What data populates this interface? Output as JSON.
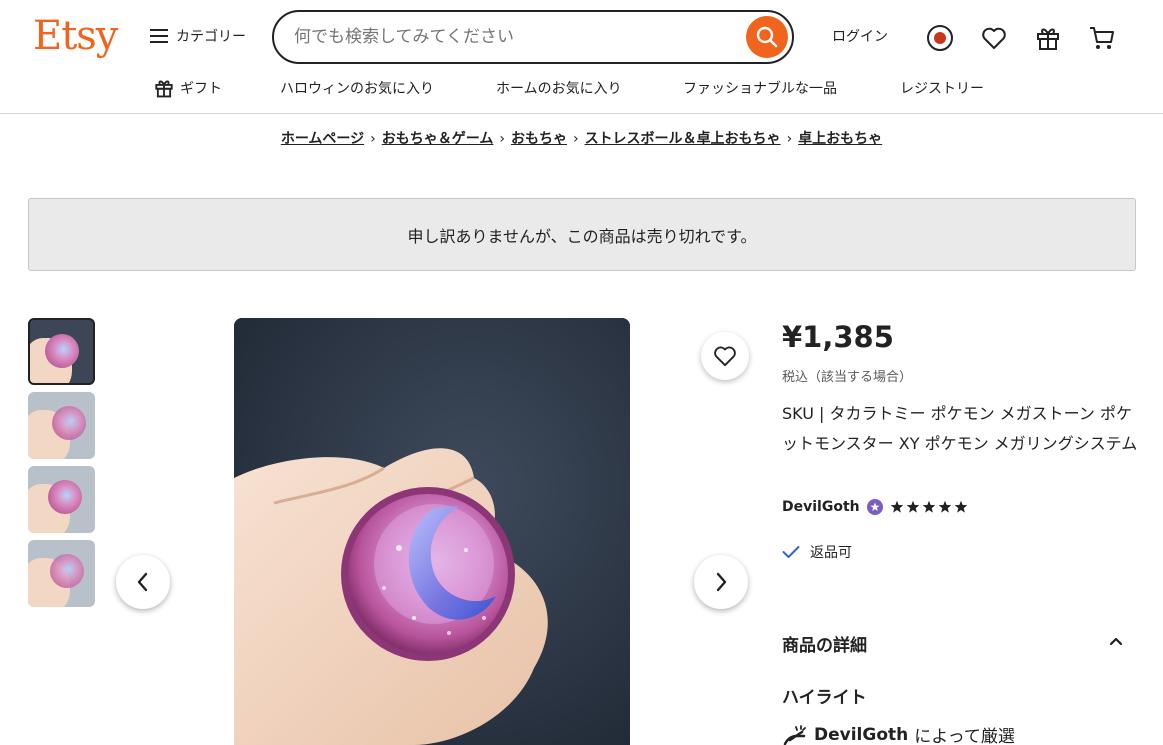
{
  "header": {
    "logo": "Etsy",
    "categories_label": "カテゴリー",
    "search_placeholder": "何でも検索してみてください",
    "login_label": "ログイン"
  },
  "nav": {
    "items": [
      {
        "label": "ギフト",
        "icon": "gift-icon"
      },
      {
        "label": "ハロウィンのお気に入り"
      },
      {
        "label": "ホームのお気に入り"
      },
      {
        "label": "ファッショナブルな一品"
      },
      {
        "label": "レジストリー"
      }
    ]
  },
  "breadcrumb": [
    "ホームページ",
    "おもちゃ＆ゲーム",
    "おもちゃ",
    "ストレスボール＆卓上おもちゃ",
    "卓上おもちゃ"
  ],
  "notice": "申し訳ありませんが、この商品は売り切れです。",
  "listing": {
    "price": "¥1,385",
    "tax_note": "税込（該当する場合）",
    "title": "SKU | タカラトミー ポケモン メガストーン ポケットモンスター XY ポケモン メガリングシステム",
    "shop_name": "DevilGoth",
    "rating": 5,
    "returns": "返品可",
    "details_heading": "商品の詳細",
    "highlights_heading": "ハイライト",
    "curated_shop": "DevilGoth",
    "curated_suffix": "によって厳選"
  },
  "colors": {
    "brand": "#f1641e",
    "text": "#222222",
    "notice_bg": "#eaeaea",
    "star_badge": "#7c5cc4"
  }
}
